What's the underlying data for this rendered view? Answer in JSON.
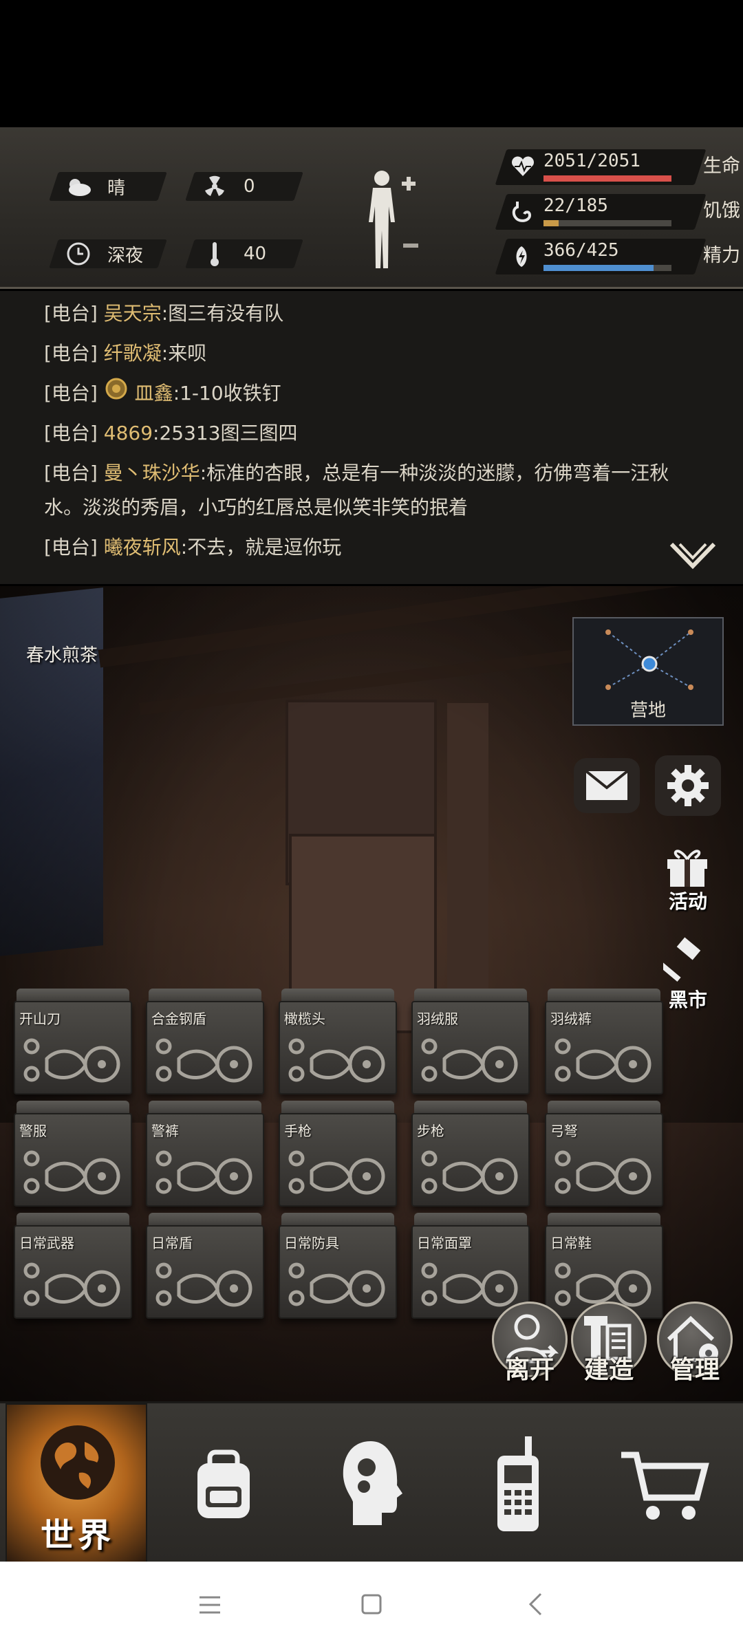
{
  "status": {
    "weather": "晴",
    "radiation": "0",
    "time_of_day": "深夜",
    "temperature": "40",
    "health": {
      "value": "2051/2051",
      "label": "生命",
      "fraction": 1.0,
      "color": "#d8504a"
    },
    "hunger": {
      "value": "22/185",
      "label": "饥饿",
      "fraction": 0.119,
      "color": "#c99a48"
    },
    "energy": {
      "value": "366/425",
      "label": "精力",
      "fraction": 0.861,
      "color": "#4f8fd0"
    }
  },
  "chat": {
    "messages": [
      {
        "tag": "[电台]",
        "name": "吴天宗",
        "text": ":图三有没有队"
      },
      {
        "tag": "[电台]",
        "name": "纤歌凝",
        "text": ":来呗"
      },
      {
        "tag": "[电台]",
        "name": "皿鑫",
        "text": ":1-10收铁钉"
      },
      {
        "tag": "[电台]",
        "name": "4869",
        "text": ":25313图三图四"
      },
      {
        "tag": "[电台]",
        "name": "曼丶珠沙华",
        "text": ":标准的杏眼，总是有一种淡淡的迷朦，彷佛弯着一汪秋",
        "text2": "水。淡淡的秀眉，小巧的红唇总是似笑非笑的抿着"
      },
      {
        "tag": "[电台]",
        "name": "曦夜斩风",
        "text": ":不去，就是逗你玩"
      }
    ]
  },
  "scene": {
    "location_name": "春水煎茶",
    "map_label": "营地",
    "side_buttons": {
      "events": "活动",
      "black_market": "黑市"
    },
    "crates": [
      "开山刀",
      "合金钢盾",
      "橄榄头",
      "羽绒服",
      "羽绒裤",
      "警服",
      "警裤",
      "手枪",
      "步枪",
      "弓弩",
      "日常武器",
      "日常盾",
      "日常防具",
      "日常面罩",
      "日常鞋"
    ],
    "actions": {
      "leave": "离开",
      "build": "建造",
      "manage": "管理"
    }
  },
  "nav": {
    "world": "世界",
    "icons": [
      "world-icon",
      "backpack-icon",
      "skills-head-icon",
      "walkie-talkie-icon",
      "shop-cart-icon"
    ]
  }
}
